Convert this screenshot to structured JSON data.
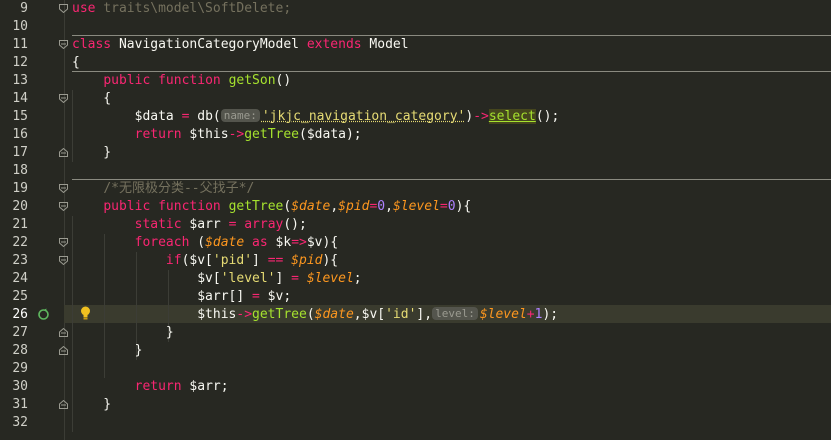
{
  "editor": {
    "current_line": "26",
    "lines": [
      {
        "num": "9"
      },
      {
        "num": "10"
      },
      {
        "num": "11"
      },
      {
        "num": "12"
      },
      {
        "num": "13"
      },
      {
        "num": "14"
      },
      {
        "num": "15"
      },
      {
        "num": "16"
      },
      {
        "num": "17"
      },
      {
        "num": "18"
      },
      {
        "num": "19"
      },
      {
        "num": "20"
      },
      {
        "num": "21"
      },
      {
        "num": "22"
      },
      {
        "num": "23"
      },
      {
        "num": "24"
      },
      {
        "num": "25"
      },
      {
        "num": "26"
      },
      {
        "num": "27"
      },
      {
        "num": "28"
      },
      {
        "num": "29"
      },
      {
        "num": "30"
      },
      {
        "num": "31"
      },
      {
        "num": "32"
      }
    ]
  },
  "code": {
    "l9_use": "use",
    "l9_path": " traits\\model\\SoftDelete;",
    "l11_class": "class",
    "l11_name": " NavigationCategoryModel ",
    "l11_extends": "extends",
    "l11_parent": " Model",
    "l12": "{",
    "l13_indent": "    ",
    "l13_public": "public",
    "l13_function": "function",
    "l13_name": "getSon",
    "l13_rest": "()",
    "l14": "    {",
    "l15_indent": "        ",
    "l15_var": "$data",
    "l15_eq": " = ",
    "l15_db": "db(",
    "l15_hint": "name:",
    "l15_str": "'jkjc_navigation_category'",
    "l15_close": ")",
    "l15_arrow": "->",
    "l15_select": "select",
    "l15_end": "();",
    "l16_indent": "        ",
    "l16_return": "return",
    "l16_this": " $this",
    "l16_arrow": "->",
    "l16_fn": "getTree",
    "l16_end": "($data);",
    "l17": "    }",
    "l19_indent": "    ",
    "l19_comment": "/*无限极分类--父找子*/",
    "l20_indent": "    ",
    "l20_public": "public",
    "l20_function": "function",
    "l20_name": "getTree",
    "l20_open": "(",
    "l20_p1": "$date",
    "l20_c1": ",",
    "l20_p2": "$pid",
    "l20_eq1": "=",
    "l20_v1": "0",
    "l20_c2": ",",
    "l20_p3": "$level",
    "l20_eq2": "=",
    "l20_v2": "0",
    "l20_end": "){",
    "l21_indent": "        ",
    "l21_static": "static",
    "l21_var": " $arr ",
    "l21_eq": "=",
    "l21_array": "array",
    "l21_end": "();",
    "l22_indent": "        ",
    "l22_foreach": "foreach",
    "l22_open": " (",
    "l22_date": "$date",
    "l22_as": " as ",
    "l22_k": "$k",
    "l22_arrow": "=>",
    "l22_v": "$v",
    "l22_end": "){",
    "l23_indent": "            ",
    "l23_if": "if",
    "l23_open": "($v[",
    "l23_str": "'pid'",
    "l23_mid": "] ",
    "l23_eq": "==",
    "l23_sp": " ",
    "l23_pid": "$pid",
    "l23_end": "){",
    "l24_indent": "                ",
    "l24_open": "$v[",
    "l24_str": "'level'",
    "l24_mid": "] ",
    "l24_eq": "=",
    "l24_sp": " ",
    "l24_level": "$level",
    "l24_end": ";",
    "l25_indent": "                ",
    "l25_open": "$arr[] ",
    "l25_eq": "=",
    "l25_end": " $v;",
    "l26_indent": "                ",
    "l26_this": "$this",
    "l26_arrow": "->",
    "l26_fn": "getTree",
    "l26_open": "(",
    "l26_date": "$date",
    "l26_c": ",$v[",
    "l26_str": "'id'",
    "l26_close": "],",
    "l26_hint": "level:",
    "l26_level": "$level",
    "l26_plus": "+",
    "l26_one": "1",
    "l26_end": ");",
    "l27": "            }",
    "l28": "        }",
    "l30_indent": "        ",
    "l30_return": "return",
    "l30_end": " $arr;",
    "l31": "    }"
  }
}
